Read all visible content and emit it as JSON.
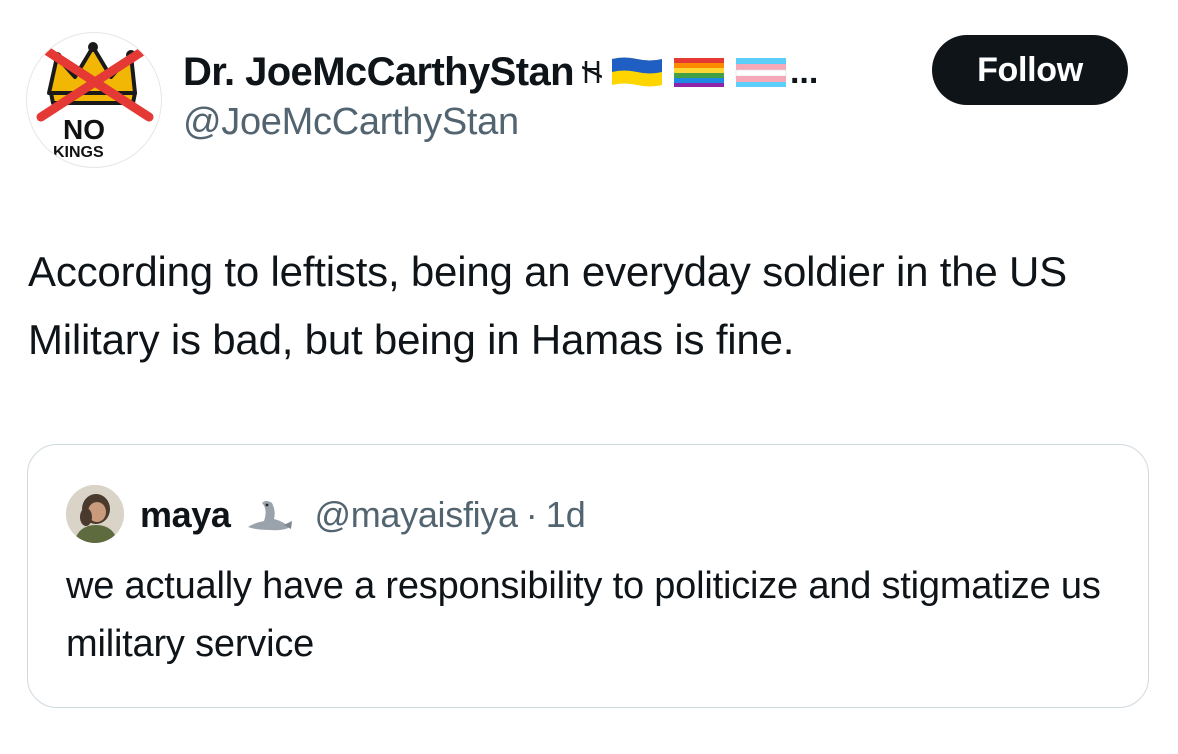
{
  "author": {
    "display_name": "Dr. JoeMcCarthyStan",
    "name_emojis": [
      "no-lions-glyph-icon",
      "ukraine-flag-icon",
      "rainbow-flag-icon",
      "transgender-flag-icon"
    ],
    "truncation": "...",
    "handle": "@JoeMcCarthyStan",
    "avatar": {
      "icon": "no-kings-crown-icon",
      "lettering_line1": "NO",
      "lettering_line2": "KINGS"
    }
  },
  "follow_button": {
    "label": "Follow"
  },
  "tweet": {
    "text": "According to leftists, being an everyday soldier in the US Military is bad, but being in Hamas is fine."
  },
  "quoted_tweet": {
    "name": "maya",
    "name_emoji": "seal-icon",
    "handle": "@mayaisfiya",
    "separator": "·",
    "time": "1d",
    "text": "we actually have a responsibility to politicize and stigmatize us military service"
  },
  "colors": {
    "text_primary": "#0f1419",
    "text_secondary": "#536471",
    "button_bg": "#0f1419",
    "border": "#cfd9de",
    "crown": "#f2b705",
    "cross_red": "#e53935"
  }
}
